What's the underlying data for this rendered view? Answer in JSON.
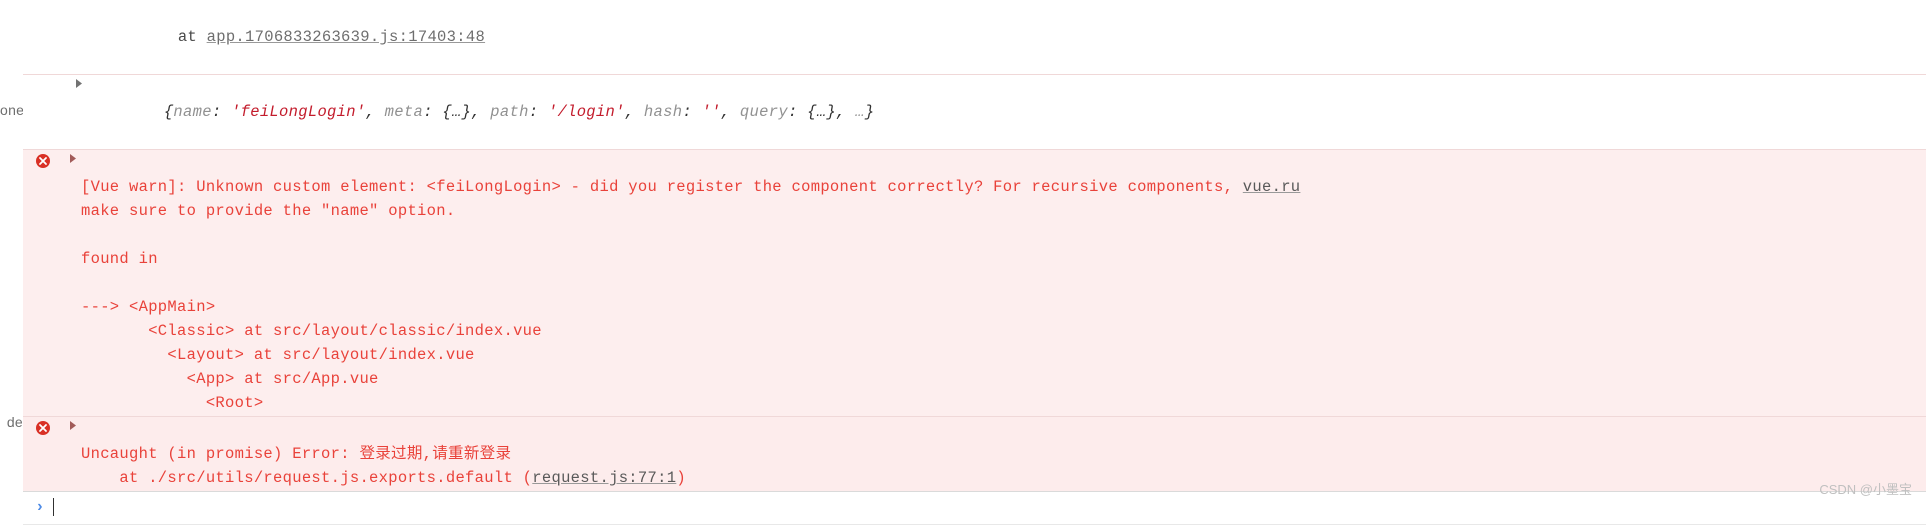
{
  "left_labels": {
    "one": "one",
    "de": "de"
  },
  "trace_top": {
    "at_prefix": "at ",
    "link": "app.1706833263639.js:17403:48"
  },
  "object_preview": {
    "open": "{",
    "entries": [
      {
        "key": "name",
        "sep": ": ",
        "val": "'feiLongLogin'",
        "trail": ", "
      },
      {
        "key": "meta",
        "sep": ": ",
        "val": "{…}",
        "trail": ", "
      },
      {
        "key": "path",
        "sep": ": ",
        "val": "'/login'",
        "trail": ", "
      },
      {
        "key": "hash",
        "sep": ": ",
        "val": "''",
        "trail": ", "
      },
      {
        "key": "query",
        "sep": ": ",
        "val": "{…}",
        "trail": ", "
      }
    ],
    "ellipsis": "…",
    "close": "}"
  },
  "vue_warn": {
    "line1_pre_link": "[Vue warn]: Unknown custom element: <feiLongLogin> - did you register the component correctly? For recursive components, ",
    "line1_link": "vue.ru",
    "line2": "make sure to provide the \"name\" option.",
    "blank": "",
    "found_in": "found in",
    "arrow": "---> <AppMain>",
    "classic": "       <Classic> at src/layout/classic/index.vue",
    "layout": "         <Layout> at src/layout/index.vue",
    "app": "           <App> at src/App.vue",
    "root": "             <Root>"
  },
  "uncaught": {
    "line1": "Uncaught (in promise) Error: 登录过期,请重新登录",
    "at_prefix": "    at ./src/utils/request.js.exports.default (",
    "link": "request.js:77:1",
    "close": ")"
  },
  "watermark": "CSDN @小墨宝"
}
